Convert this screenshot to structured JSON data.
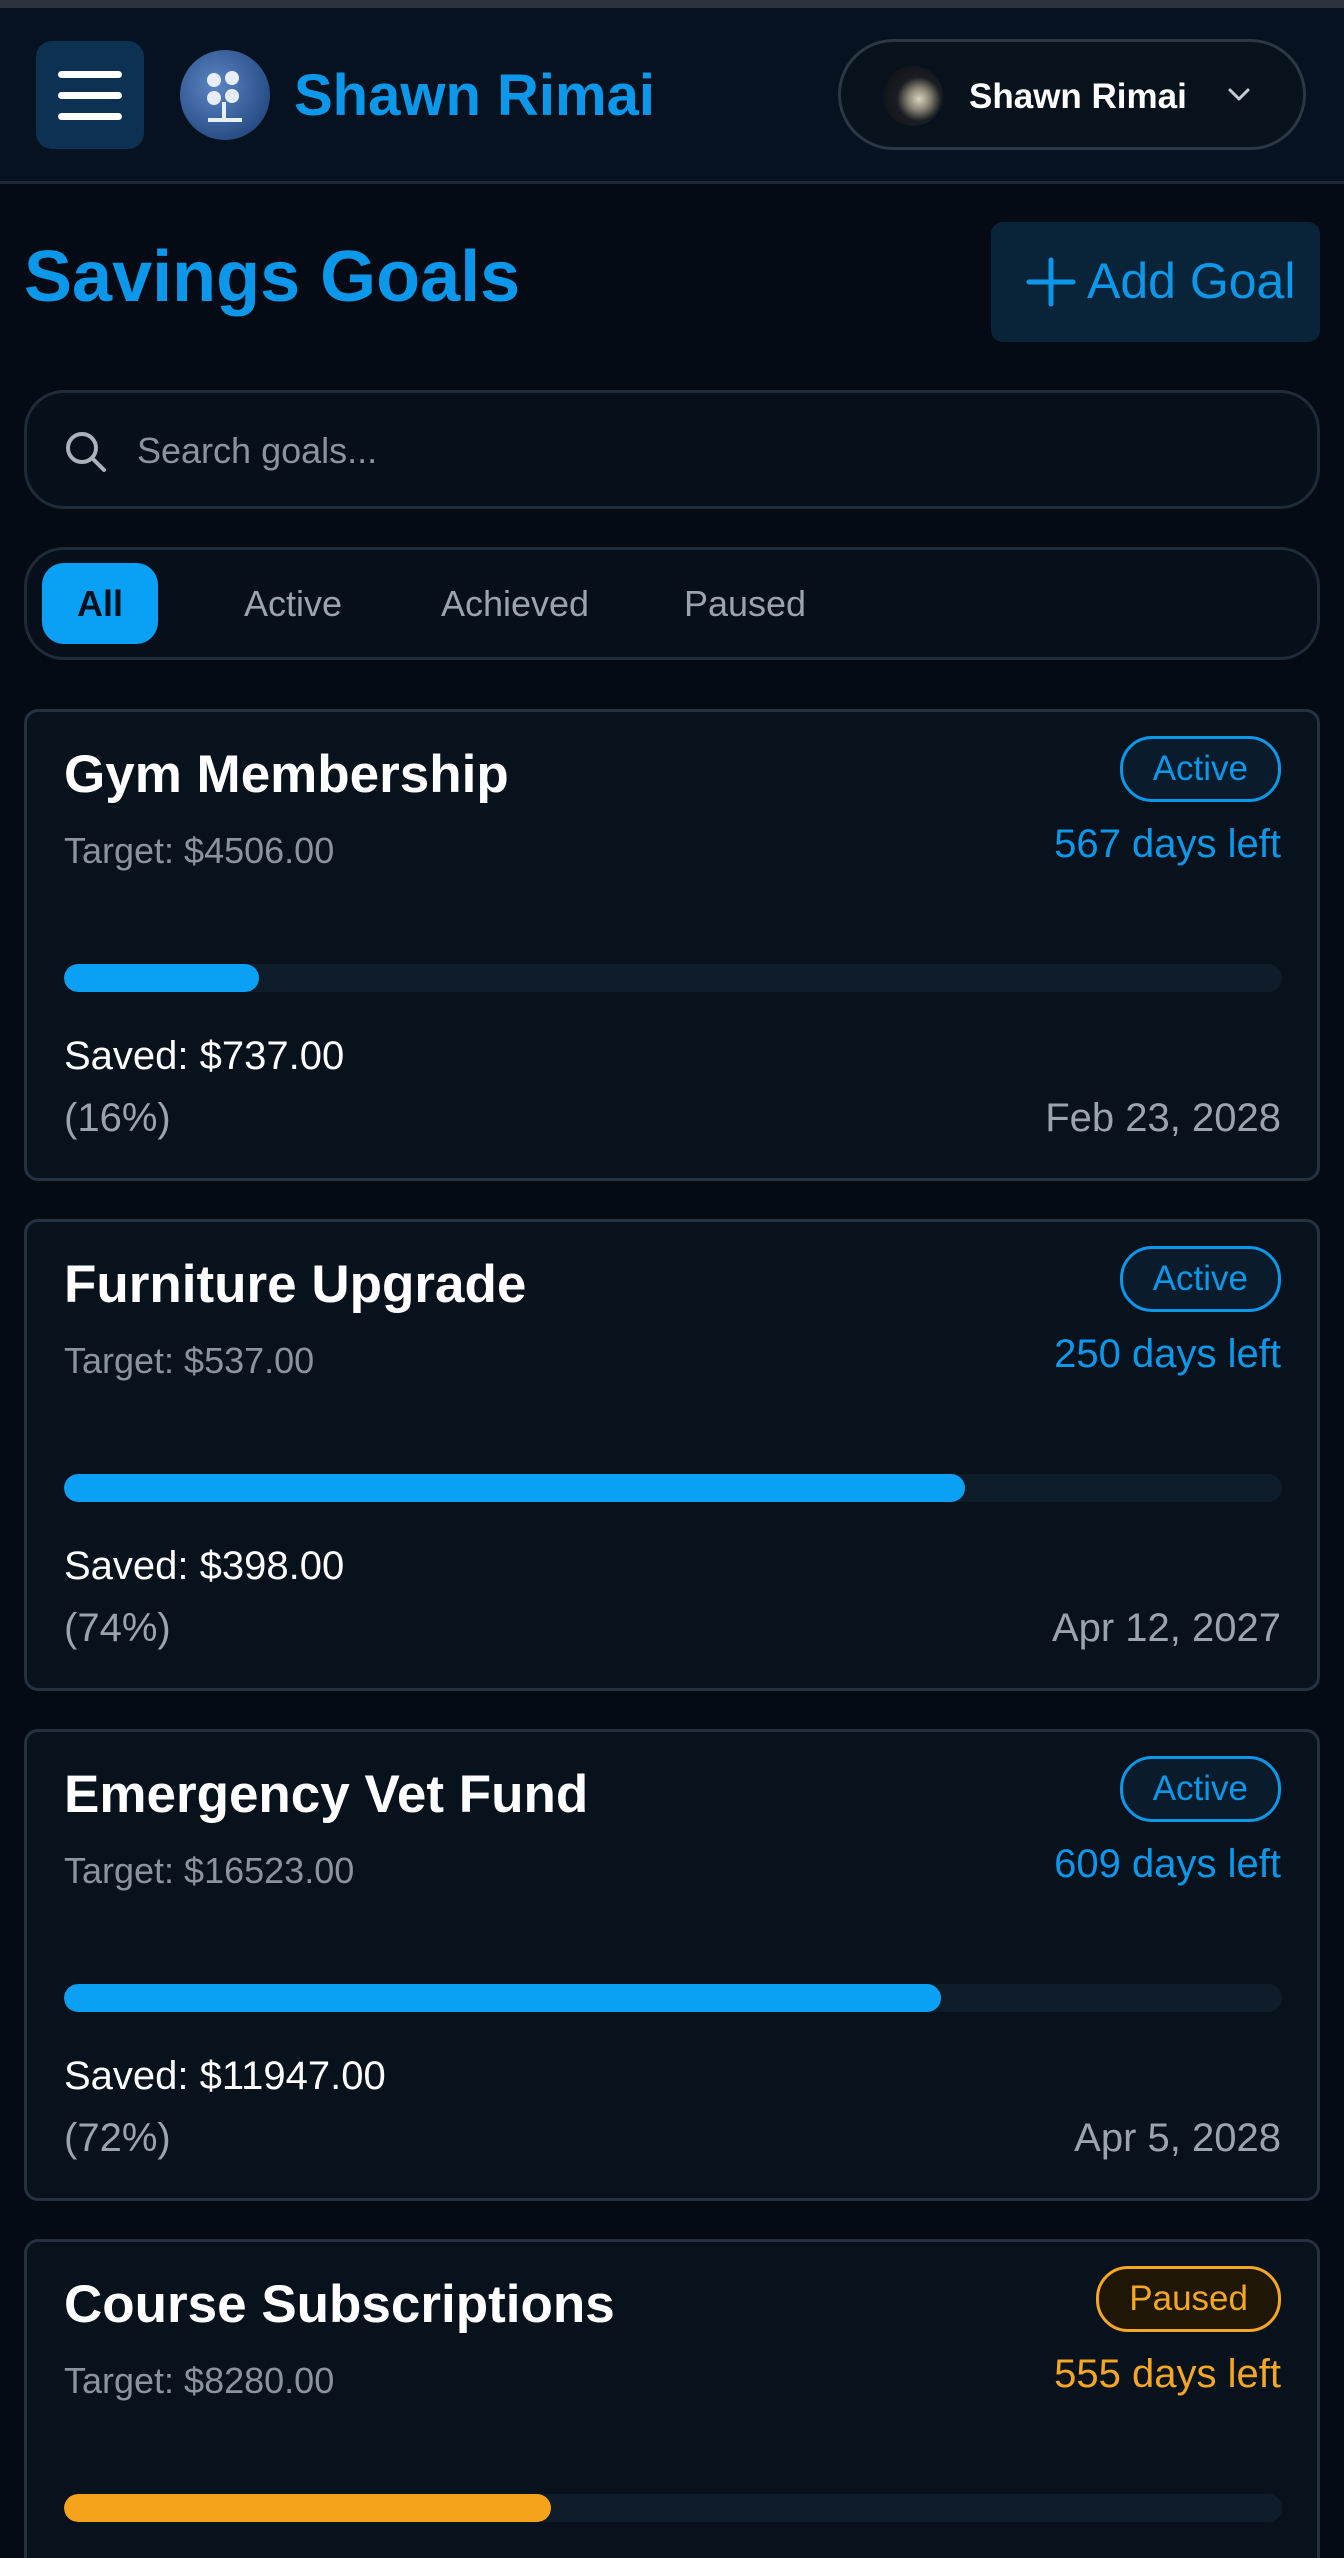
{
  "header": {
    "brand_name": "Shawn Rimai",
    "user_name": "Shawn Rimai",
    "icons": {
      "menu": "hamburger-menu-icon",
      "logo": "brand-logo",
      "avatar": "user-avatar",
      "dropdown": "chevron-down-icon"
    }
  },
  "page": {
    "title": "Savings Goals",
    "add_goal_label": "Add Goal"
  },
  "search": {
    "placeholder": "Search goals...",
    "value": ""
  },
  "filters": [
    "All",
    "Active",
    "Achieved",
    "Paused"
  ],
  "selected_filter": "All",
  "colors": {
    "accent": "#0b98ea",
    "paused": "#f5a623",
    "background": "#040b14",
    "card": "#08121d"
  },
  "goals": [
    {
      "name": "Gym Membership",
      "target": "Target: $4506.00",
      "status": "Active",
      "days_left": "567 days left",
      "saved": "Saved: $737.00",
      "percent": "(16%)",
      "progress": 0.16,
      "date": "Feb 23, 2028"
    },
    {
      "name": "Furniture Upgrade",
      "target": "Target: $537.00",
      "status": "Active",
      "days_left": "250 days left",
      "saved": "Saved: $398.00",
      "percent": "(74%)",
      "progress": 0.74,
      "date": "Apr 12, 2027"
    },
    {
      "name": "Emergency Vet Fund",
      "target": "Target: $16523.00",
      "status": "Active",
      "days_left": "609 days left",
      "saved": "Saved: $11947.00",
      "percent": "(72%)",
      "progress": 0.72,
      "date": "Apr 5, 2028"
    },
    {
      "name": "Course Subscriptions",
      "target": "Target: $8280.00",
      "status": "Paused",
      "days_left": "555 days left",
      "saved": "",
      "percent": "",
      "progress": 0.4,
      "date": ""
    }
  ]
}
